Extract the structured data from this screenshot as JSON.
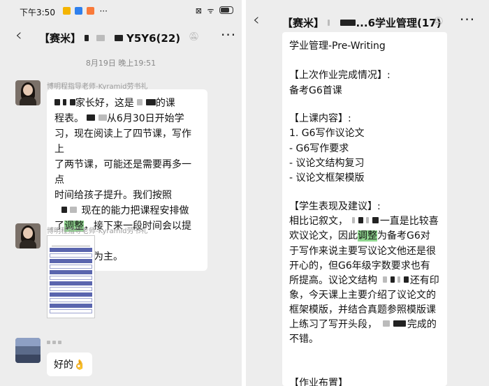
{
  "status_bar": {
    "time": "下午3:50",
    "extra": "···",
    "icons": "⊠ ᯤ"
  },
  "left": {
    "back_icon": "‹",
    "title_prefix": "【赛米】",
    "title_suffix": "Y5Y6(22)",
    "mute_icon": "bell-off-icon",
    "more_icon": "···",
    "timestamp": "8月19日 晚上19:51",
    "messages": [
      {
        "sender": "博明程指导老师-Kyramid劳书礼",
        "lines": [
          {
            "pre": "",
            "post": "家长好，这是",
            "tail": "的课"
          },
          {
            "text": "程表。",
            "tail": "从6月30日开始学"
          },
          {
            "text": "习，现在阅读上了四节课，写作上"
          },
          {
            "text": "了两节课，可能还是需要再多一点"
          },
          {
            "text": "时间给孩子提升。我们按照"
          },
          {
            "text": "现在的能力把课程安排做"
          },
          {
            "before": "了",
            "highlight": "调整",
            "after": "，接下来一段时间会以提升"
          },
          {
            "text": "英语能力为主。"
          }
        ]
      },
      {
        "sender": "博明程指导老师-Kyramid劳书礼",
        "type": "image"
      },
      {
        "reply": "好的👌"
      }
    ]
  },
  "right": {
    "back_icon": "‹",
    "title_prefix": "【赛米】",
    "title_suffix": "...6学业管理(17)",
    "mute_icon": "bell-off-icon",
    "more_icon": "···",
    "lines": [
      "学业管理-Pre-Writing",
      "",
      "【上次作业完成情况】:",
      "备考G6首课",
      "",
      "【上课内容】:",
      "1. G6写作议论文",
      "- G6写作要求",
      "- 议论文结构复习",
      "- 议论文框架模版",
      "",
      "【学生表现及建议】:",
      "相比记叙文，",
      "一直是比较喜",
      "欢议论文，因此",
      "调整",
      "为备考G6对",
      "于写作来说主要写议论文他还是很",
      "开心的，但G6年级字数要求也有",
      "所提高。议论文结构",
      "还有印",
      "象，今天课上主要介绍了议论文的",
      "框架模版，并结合真题参照模版课",
      "上练习了写开头段，",
      "完成的",
      "不错。",
      "【作业布置】"
    ]
  }
}
